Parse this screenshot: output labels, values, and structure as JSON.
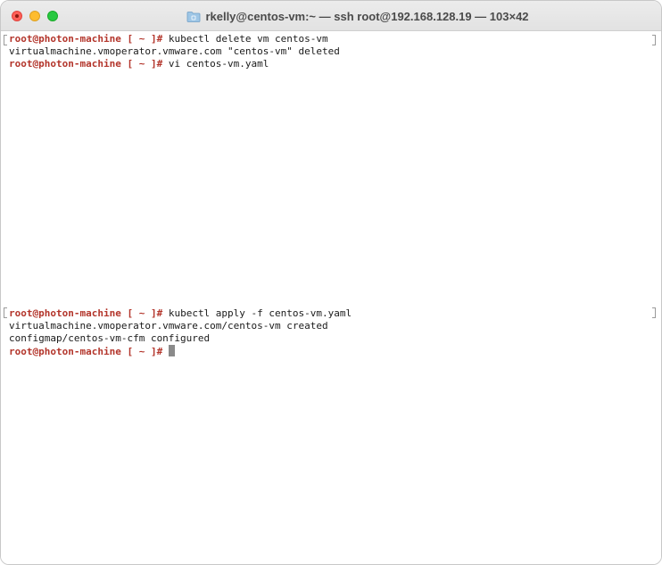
{
  "window": {
    "title": "rkelly@centos-vm:~ — ssh root@192.168.128.19 — 103×42"
  },
  "terminal": {
    "prompt_user": "root@photon-machine",
    "prompt_rest": " [ ~ ]#",
    "lines": [
      {
        "type": "prompt",
        "command": " kubectl delete vm centos-vm"
      },
      {
        "type": "output",
        "text": "virtualmachine.vmoperator.vmware.com \"centos-vm\" deleted"
      },
      {
        "type": "prompt",
        "command": " vi centos-vm.yaml"
      },
      {
        "type": "prompt",
        "command": " kubectl apply -f centos-vm.yaml"
      },
      {
        "type": "output",
        "text": "virtualmachine.vmoperator.vmware.com/centos-vm created"
      },
      {
        "type": "output",
        "text": "configmap/centos-vm-cfm configured"
      },
      {
        "type": "prompt",
        "command": " "
      }
    ]
  },
  "colors": {
    "prompt": "#b3352b",
    "cursor": "#8a8a8a"
  }
}
